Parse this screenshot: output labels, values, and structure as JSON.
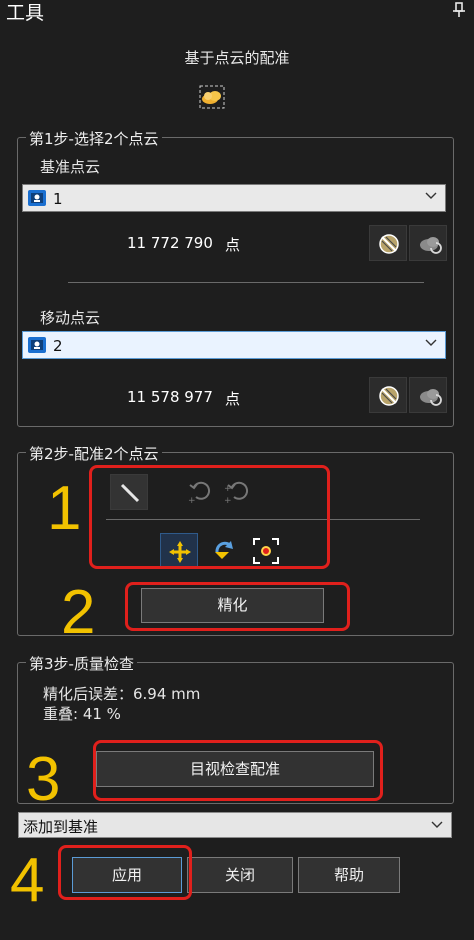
{
  "panel": {
    "title": "工具",
    "subtitle": "基于点云的配准"
  },
  "step1": {
    "legend": "第1步-选择2个点云",
    "base_label": "基准点云",
    "base_value": "1",
    "base_count": "11 772 790",
    "base_unit": "点",
    "move_label": "移动点云",
    "move_value": "2",
    "move_count": "11 578 977",
    "move_unit": "点"
  },
  "step2": {
    "legend": "第2步-配准2个点云",
    "refine_label": "精化"
  },
  "step3": {
    "legend": "第3步-质量检查",
    "error_text": "精化后误差：6.94 mm",
    "overlap_text": "重叠: 41 %",
    "visual_check_label": "目视检查配准"
  },
  "bottom": {
    "add_option": "添加到基准",
    "apply_label": "应用",
    "close_label": "关闭",
    "help_label": "帮助"
  },
  "annotations": [
    "1",
    "2",
    "3",
    "4"
  ],
  "colors": {
    "accent_red": "#e0201c",
    "annotation_yellow": "#f2c200",
    "background": "#1e1e1e"
  },
  "icons": [
    "pin-icon",
    "cloud-register-icon",
    "point-cloud-icon",
    "filter-icon",
    "cloud-refresh-icon",
    "line-tool-icon",
    "undo-icon",
    "redo-icon",
    "move-icon",
    "rotate-icon",
    "target-icon",
    "chevron-down-icon"
  ]
}
